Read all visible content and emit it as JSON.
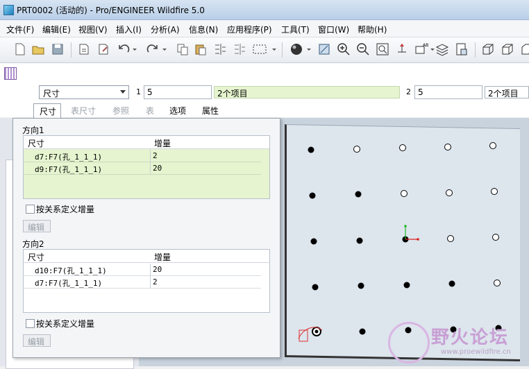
{
  "window": {
    "title": "PRT0002 (活动的) - Pro/ENGINEER Wildfire 5.0"
  },
  "menu": [
    "文件(F)",
    "编辑(E)",
    "视图(V)",
    "插入(I)",
    "分析(A)",
    "信息(N)",
    "应用程序(P)",
    "工具(T)",
    "窗口(W)",
    "帮助(H)"
  ],
  "dashboard": {
    "type_value": "尺寸",
    "dir1_label": "1",
    "dir1_count": "5",
    "dir1_items": "2个项目",
    "dir2_label": "2",
    "dir2_count": "5",
    "dir2_items": "2个项目",
    "tabs": [
      "尺寸",
      "表尺寸",
      "参照",
      "表",
      "选项",
      "属性"
    ]
  },
  "panel": {
    "direction1": {
      "title": "方向1",
      "columns": [
        "尺寸",
        "增量"
      ],
      "rows": [
        {
          "dim": "d7:F7(孔_1_1_1)",
          "inc": "2"
        },
        {
          "dim": "d9:F7(孔_1_1_1)",
          "inc": "20"
        }
      ],
      "checkbox_label": "按关系定义增量",
      "edit_label": "编辑"
    },
    "direction2": {
      "title": "方向2",
      "columns": [
        "尺寸",
        "增量"
      ],
      "rows": [
        {
          "dim": "d10:F7(孔_1_1_1)",
          "inc": "20"
        },
        {
          "dim": "d7:F7(孔_1_1_1)",
          "inc": "2"
        }
      ],
      "checkbox_label": "按关系定义增量",
      "edit_label": "编辑"
    }
  },
  "watermark": {
    "text": "野火论坛",
    "url": "www.proewildfire.cn"
  },
  "colors": {
    "green_selection": "#e6f4cf",
    "titlebar": "#c6d8ee"
  }
}
